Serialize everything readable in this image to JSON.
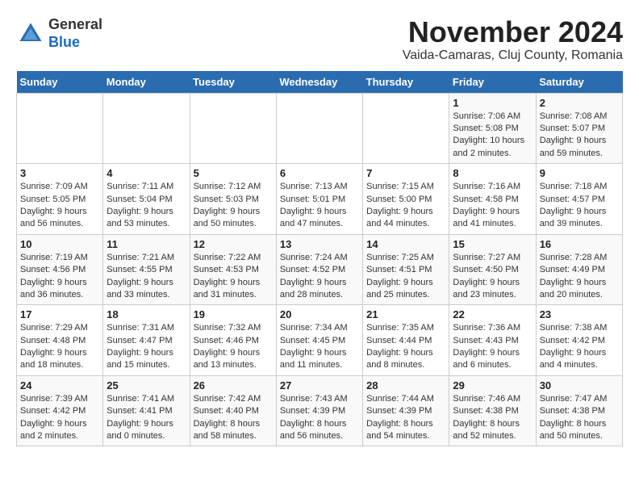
{
  "header": {
    "logo_general": "General",
    "logo_blue": "Blue",
    "month_title": "November 2024",
    "location": "Vaida-Camaras, Cluj County, Romania"
  },
  "weekdays": [
    "Sunday",
    "Monday",
    "Tuesday",
    "Wednesday",
    "Thursday",
    "Friday",
    "Saturday"
  ],
  "weeks": [
    [
      {
        "day": "",
        "info": ""
      },
      {
        "day": "",
        "info": ""
      },
      {
        "day": "",
        "info": ""
      },
      {
        "day": "",
        "info": ""
      },
      {
        "day": "",
        "info": ""
      },
      {
        "day": "1",
        "info": "Sunrise: 7:06 AM\nSunset: 5:08 PM\nDaylight: 10 hours and 2 minutes."
      },
      {
        "day": "2",
        "info": "Sunrise: 7:08 AM\nSunset: 5:07 PM\nDaylight: 9 hours and 59 minutes."
      }
    ],
    [
      {
        "day": "3",
        "info": "Sunrise: 7:09 AM\nSunset: 5:05 PM\nDaylight: 9 hours and 56 minutes."
      },
      {
        "day": "4",
        "info": "Sunrise: 7:11 AM\nSunset: 5:04 PM\nDaylight: 9 hours and 53 minutes."
      },
      {
        "day": "5",
        "info": "Sunrise: 7:12 AM\nSunset: 5:03 PM\nDaylight: 9 hours and 50 minutes."
      },
      {
        "day": "6",
        "info": "Sunrise: 7:13 AM\nSunset: 5:01 PM\nDaylight: 9 hours and 47 minutes."
      },
      {
        "day": "7",
        "info": "Sunrise: 7:15 AM\nSunset: 5:00 PM\nDaylight: 9 hours and 44 minutes."
      },
      {
        "day": "8",
        "info": "Sunrise: 7:16 AM\nSunset: 4:58 PM\nDaylight: 9 hours and 41 minutes."
      },
      {
        "day": "9",
        "info": "Sunrise: 7:18 AM\nSunset: 4:57 PM\nDaylight: 9 hours and 39 minutes."
      }
    ],
    [
      {
        "day": "10",
        "info": "Sunrise: 7:19 AM\nSunset: 4:56 PM\nDaylight: 9 hours and 36 minutes."
      },
      {
        "day": "11",
        "info": "Sunrise: 7:21 AM\nSunset: 4:55 PM\nDaylight: 9 hours and 33 minutes."
      },
      {
        "day": "12",
        "info": "Sunrise: 7:22 AM\nSunset: 4:53 PM\nDaylight: 9 hours and 31 minutes."
      },
      {
        "day": "13",
        "info": "Sunrise: 7:24 AM\nSunset: 4:52 PM\nDaylight: 9 hours and 28 minutes."
      },
      {
        "day": "14",
        "info": "Sunrise: 7:25 AM\nSunset: 4:51 PM\nDaylight: 9 hours and 25 minutes."
      },
      {
        "day": "15",
        "info": "Sunrise: 7:27 AM\nSunset: 4:50 PM\nDaylight: 9 hours and 23 minutes."
      },
      {
        "day": "16",
        "info": "Sunrise: 7:28 AM\nSunset: 4:49 PM\nDaylight: 9 hours and 20 minutes."
      }
    ],
    [
      {
        "day": "17",
        "info": "Sunrise: 7:29 AM\nSunset: 4:48 PM\nDaylight: 9 hours and 18 minutes."
      },
      {
        "day": "18",
        "info": "Sunrise: 7:31 AM\nSunset: 4:47 PM\nDaylight: 9 hours and 15 minutes."
      },
      {
        "day": "19",
        "info": "Sunrise: 7:32 AM\nSunset: 4:46 PM\nDaylight: 9 hours and 13 minutes."
      },
      {
        "day": "20",
        "info": "Sunrise: 7:34 AM\nSunset: 4:45 PM\nDaylight: 9 hours and 11 minutes."
      },
      {
        "day": "21",
        "info": "Sunrise: 7:35 AM\nSunset: 4:44 PM\nDaylight: 9 hours and 8 minutes."
      },
      {
        "day": "22",
        "info": "Sunrise: 7:36 AM\nSunset: 4:43 PM\nDaylight: 9 hours and 6 minutes."
      },
      {
        "day": "23",
        "info": "Sunrise: 7:38 AM\nSunset: 4:42 PM\nDaylight: 9 hours and 4 minutes."
      }
    ],
    [
      {
        "day": "24",
        "info": "Sunrise: 7:39 AM\nSunset: 4:42 PM\nDaylight: 9 hours and 2 minutes."
      },
      {
        "day": "25",
        "info": "Sunrise: 7:41 AM\nSunset: 4:41 PM\nDaylight: 9 hours and 0 minutes."
      },
      {
        "day": "26",
        "info": "Sunrise: 7:42 AM\nSunset: 4:40 PM\nDaylight: 8 hours and 58 minutes."
      },
      {
        "day": "27",
        "info": "Sunrise: 7:43 AM\nSunset: 4:39 PM\nDaylight: 8 hours and 56 minutes."
      },
      {
        "day": "28",
        "info": "Sunrise: 7:44 AM\nSunset: 4:39 PM\nDaylight: 8 hours and 54 minutes."
      },
      {
        "day": "29",
        "info": "Sunrise: 7:46 AM\nSunset: 4:38 PM\nDaylight: 8 hours and 52 minutes."
      },
      {
        "day": "30",
        "info": "Sunrise: 7:47 AM\nSunset: 4:38 PM\nDaylight: 8 hours and 50 minutes."
      }
    ]
  ]
}
